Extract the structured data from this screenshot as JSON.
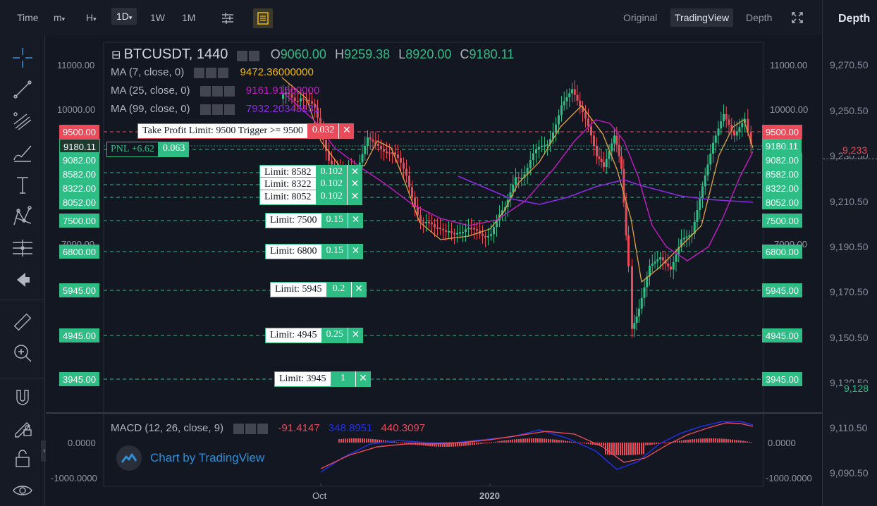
{
  "topbar": {
    "time": "Time",
    "minute": "m",
    "hour": "H",
    "day": "1D",
    "week": "1W",
    "month": "1M",
    "view_original": "Original",
    "view_tradingview": "TradingView",
    "view_depth": "Depth"
  },
  "depth": {
    "title": "Depth",
    "labels": [
      "9,270.50",
      "9,250.50",
      "9,230.50",
      "9,210.50",
      "9,190.50",
      "9,170.50",
      "9,150.50",
      "9,130.50",
      "9,110.50",
      "9,090.50"
    ],
    "sell_marker": "9,233",
    "buy_marker": "9,128"
  },
  "legend": {
    "symbol": "BTCUSDT, 1440",
    "o_label": "O",
    "o": "9060.00",
    "h_label": "H",
    "h": "9259.38",
    "l_label": "L",
    "l": "8920.00",
    "c_label": "C",
    "c": "9180.11",
    "ma7": "MA (7, close, 0)",
    "ma7_val": "9472.36000000",
    "ma25": "MA (25, close, 0)",
    "ma25_val": "9161.91560000",
    "ma99": "MA (99, close, 0)",
    "ma99_val": "7932.20343131",
    "macd": "MACD (12, 26, close, 9)",
    "macd_v1": "-91.4147",
    "macd_v2": "348.8951",
    "macd_v3": "440.3097"
  },
  "colors": {
    "up": "#2ebd85",
    "down": "#e84b5a",
    "ma7": "#e0a240",
    "ma25": "#c21cc4",
    "ma99": "#8a2be2",
    "accent": "#f0b90b"
  },
  "price_axis": {
    "left": [
      "11000.00",
      "10000.00",
      "7000.00"
    ],
    "right": [
      "11000.00",
      "10000.00",
      "7000.00"
    ],
    "macd_left": [
      "0.0000",
      "-1000.0000"
    ],
    "macd_right": [
      "0.0000",
      "-1000.0000"
    ]
  },
  "price_tags": {
    "p9500": "9500.00",
    "p9180": "9180.11",
    "p9082": "9082.00",
    "p8582": "8582.00",
    "p8322": "8322.00",
    "p8052": "8052.00",
    "p7500": "7500.00",
    "p6800": "6800.00",
    "p5945": "5945.00",
    "p4945": "4945.00",
    "p3945": "3945.00"
  },
  "orders": {
    "tp_label": "Take Profit Limit: 9500 Trigger >= 9500",
    "tp_qty": "0.032",
    "pnl_label": "PNL +6.62",
    "pnl_qty": "0.063",
    "o8582": "Limit: 8582",
    "q8582": "0.102",
    "o8322": "Limit: 8322",
    "q8322": "0.102",
    "o8052": "Limit: 8052",
    "q8052": "0.102",
    "o7500": "Limit: 7500",
    "q7500": "0.15",
    "o6800": "Limit: 6800",
    "q6800": "0.15",
    "o5945": "Limit: 5945",
    "q5945": "0.2",
    "o4945": "Limit: 4945",
    "q4945": "0.25",
    "o3945": "Limit: 3945",
    "q3945": "1",
    "close_glyph": "✕"
  },
  "time_axis": {
    "oct": "Oct",
    "y2020": "2020"
  },
  "watermark": "Chart by TradingView"
}
